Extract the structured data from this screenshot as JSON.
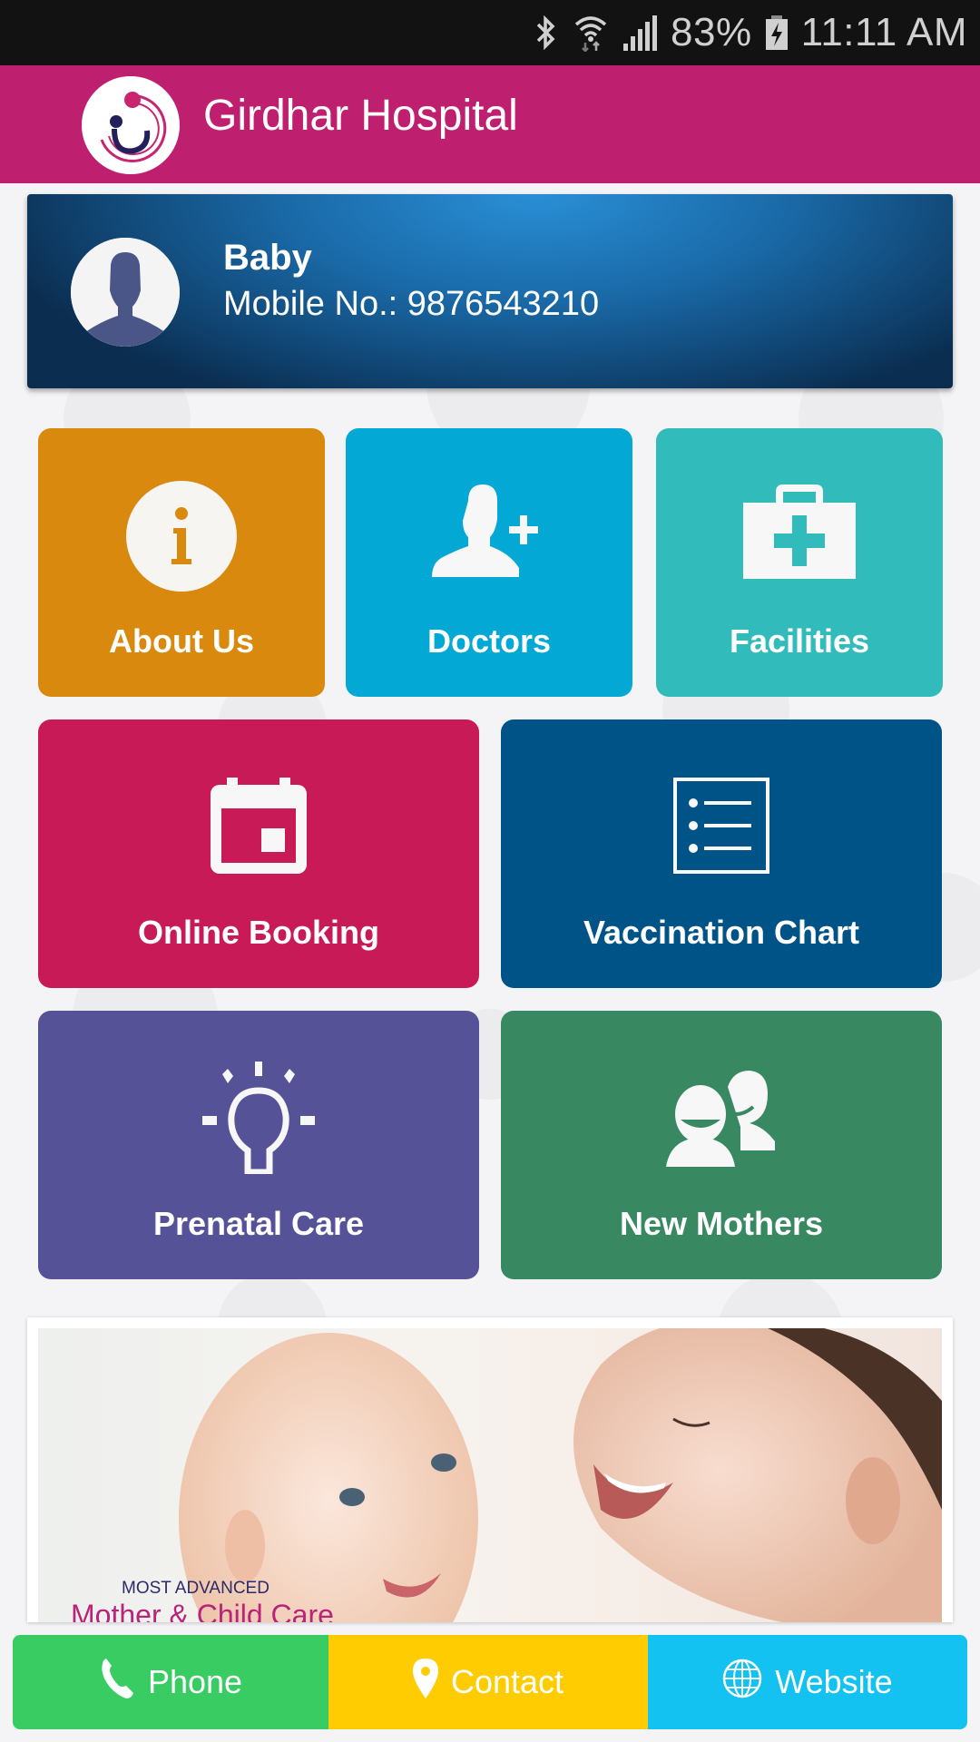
{
  "status_bar": {
    "battery_percent": "83%",
    "time": "11:11 AM",
    "icons": [
      "bluetooth-icon",
      "wifi-icon",
      "signal-icon",
      "battery-charging-icon"
    ]
  },
  "header": {
    "title": "Girdhar Hospital",
    "logo": "hospital-logo",
    "bar_color": "#bf1f6f"
  },
  "profile": {
    "name": "Baby",
    "mobile": "Mobile No.: 9876543210",
    "avatar": "default-user-avatar"
  },
  "tiles": [
    {
      "label": "About Us",
      "icon": "info-icon",
      "color": "#d98a0e"
    },
    {
      "label": "Doctors",
      "icon": "add-user-icon",
      "color": "#04a8d4"
    },
    {
      "label": "Facilities",
      "icon": "medical-kit-icon",
      "color": "#31bbbb"
    },
    {
      "label": "Online Booking",
      "icon": "calendar-icon",
      "color": "#c81a57"
    },
    {
      "label": "Vaccination Chart",
      "icon": "list-icon",
      "color": "#005386"
    },
    {
      "label": "Prenatal Care",
      "icon": "lightbulb-icon",
      "color": "#555298"
    },
    {
      "label": "New Mothers",
      "icon": "users-icon",
      "color": "#388962"
    }
  ],
  "banner": {
    "subtitle": "MOST ADVANCED",
    "title": "Mother & Child Care"
  },
  "bottom_bar": [
    {
      "label": "Phone",
      "icon": "phone-icon",
      "color": "#38cc62"
    },
    {
      "label": "Contact",
      "icon": "location-pin-icon",
      "color": "#fecc00"
    },
    {
      "label": "Website",
      "icon": "globe-icon",
      "color": "#14c2f2"
    }
  ]
}
